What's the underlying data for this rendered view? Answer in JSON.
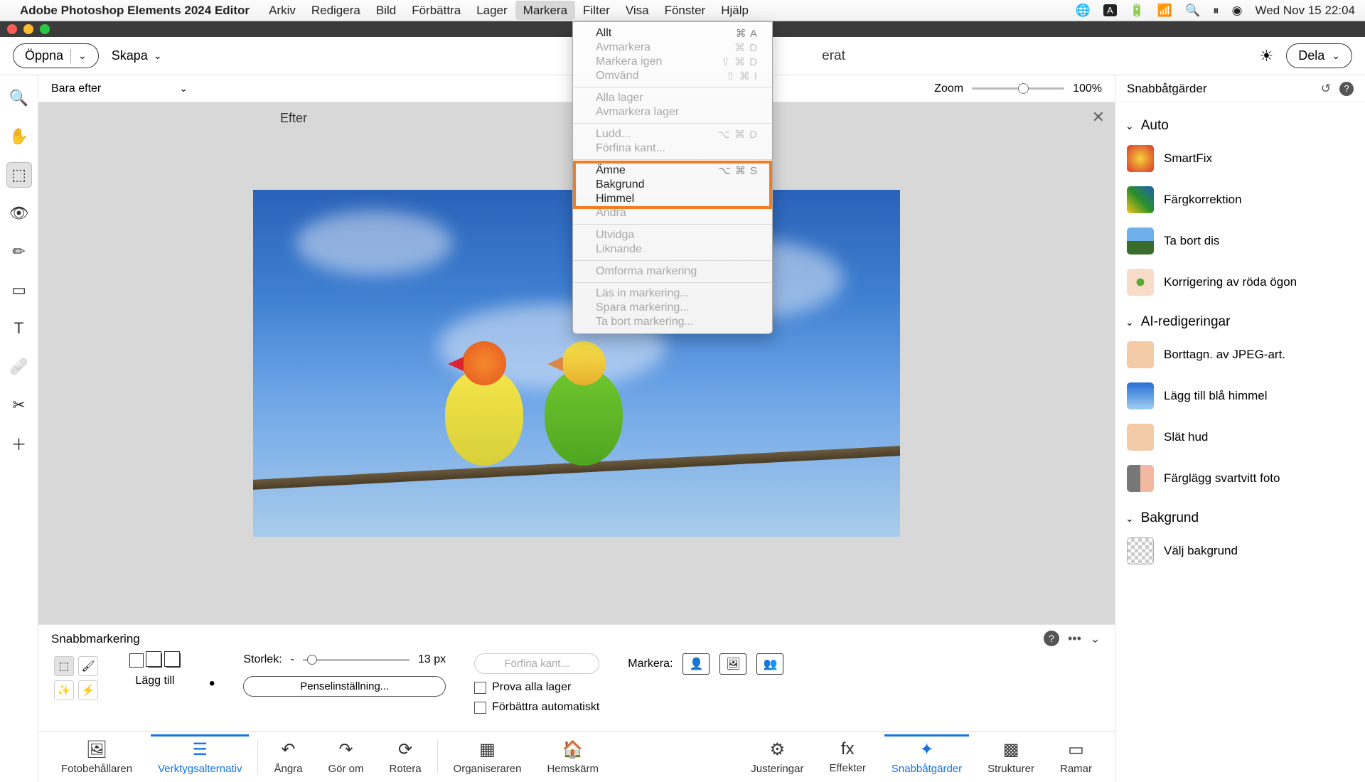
{
  "mac": {
    "app": "Adobe Photoshop Elements 2024 Editor",
    "menus": [
      "Arkiv",
      "Redigera",
      "Bild",
      "Förbättra",
      "Lager",
      "Markera",
      "Filter",
      "Visa",
      "Fönster",
      "Hjälp"
    ],
    "active_menu_index": 5,
    "clock": "Wed Nov 15 22:04"
  },
  "topbar": {
    "open": "Öppna",
    "create": "Skapa",
    "mode_right": "erat",
    "share": "Dela"
  },
  "viewbar": {
    "mode": "Bara efter",
    "zoom_label": "Zoom",
    "zoom_value": "100%"
  },
  "canvas": {
    "label": "Efter"
  },
  "dropdown": {
    "groups": [
      [
        {
          "label": "Allt",
          "sc": "⌘ A",
          "dim": false
        },
        {
          "label": "Avmarkera",
          "sc": "⌘ D",
          "dim": true
        },
        {
          "label": "Markera igen",
          "sc": "⇧ ⌘ D",
          "dim": true
        },
        {
          "label": "Omvänd",
          "sc": "⇧ ⌘ I",
          "dim": true
        }
      ],
      [
        {
          "label": "Alla lager",
          "sc": "",
          "dim": true
        },
        {
          "label": "Avmarkera lager",
          "sc": "",
          "dim": true
        }
      ],
      [
        {
          "label": "Ludd...",
          "sc": "⌥ ⌘ D",
          "dim": true
        },
        {
          "label": "Förfina kant...",
          "sc": "",
          "dim": true
        }
      ],
      [
        {
          "label": "Ämne",
          "sc": "⌥ ⌘ S",
          "dim": false
        },
        {
          "label": "Bakgrund",
          "sc": "",
          "dim": false
        },
        {
          "label": "Himmel",
          "sc": "",
          "dim": false
        },
        {
          "label": "Ändra",
          "sc": "",
          "dim": true
        }
      ],
      [
        {
          "label": "Utvidga",
          "sc": "",
          "dim": true
        },
        {
          "label": "Liknande",
          "sc": "",
          "dim": true
        }
      ],
      [
        {
          "label": "Omforma markering",
          "sc": "",
          "dim": true
        }
      ],
      [
        {
          "label": "Läs in markering...",
          "sc": "",
          "dim": true
        },
        {
          "label": "Spara markering...",
          "sc": "",
          "dim": true
        },
        {
          "label": "Ta bort markering...",
          "sc": "",
          "dim": true
        }
      ]
    ],
    "highlight_group": 3
  },
  "opts": {
    "title": "Snabbmarkering",
    "add": "Lägg till",
    "size_label": "Storlek:",
    "size_value": "13 px",
    "refine": "Förfina kant...",
    "brush": "Penselinställning...",
    "chk1": "Prova alla lager",
    "chk2": "Förbättra automatiskt",
    "mark": "Markera:"
  },
  "bottom": {
    "tabs_left": [
      "Fotobehållaren",
      "Verktygsalternativ",
      "Ångra",
      "Gör om",
      "Rotera",
      "Organiseraren",
      "Hemskärm"
    ],
    "tabs_right": [
      "Justeringar",
      "Effekter",
      "Snabbåtgärder",
      "Strukturer",
      "Ramar"
    ],
    "active_left": 1,
    "active_right": 2
  },
  "rpanel": {
    "title": "Snabbåtgärder",
    "sections": [
      {
        "title": "Auto",
        "items": [
          {
            "label": "SmartFix",
            "th": "th-flower"
          },
          {
            "label": "Färgkorrektion",
            "th": "th-color"
          },
          {
            "label": "Ta bort dis",
            "th": "th-mtn"
          },
          {
            "label": "Korrigering av röda ögon",
            "th": "th-eye"
          }
        ]
      },
      {
        "title": "AI-redigeringar",
        "items": [
          {
            "label": "Borttagn. av JPEG-art.",
            "th": "th-face"
          },
          {
            "label": "Lägg till blå himmel",
            "th": "th-sky"
          },
          {
            "label": "Slät hud",
            "th": "th-face"
          },
          {
            "label": "Färglägg svartvitt foto",
            "th": "th-bw"
          }
        ]
      },
      {
        "title": "Bakgrund",
        "items": [
          {
            "label": "Välj bakgrund",
            "th": "th-sel"
          }
        ]
      }
    ]
  }
}
